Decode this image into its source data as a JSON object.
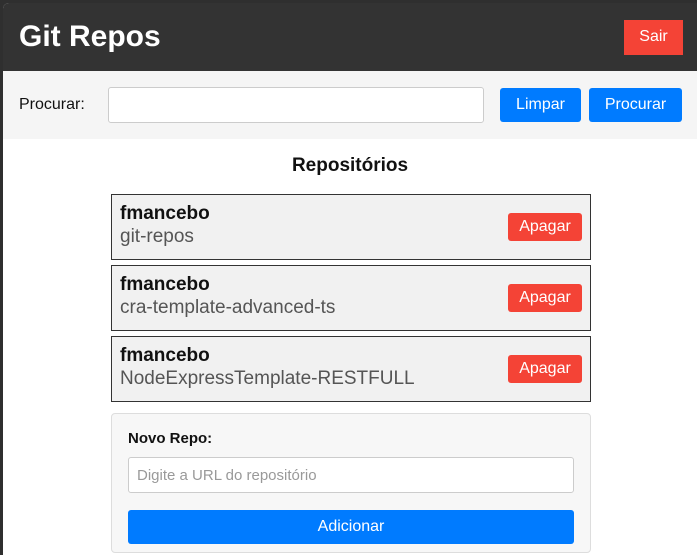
{
  "header": {
    "title": "Git Repos",
    "logout_label": "Sair"
  },
  "search": {
    "label": "Procurar:",
    "value": "",
    "placeholder": "",
    "clear_label": "Limpar",
    "submit_label": "Procurar"
  },
  "repos": {
    "title": "Repositórios",
    "delete_label": "Apagar",
    "items": [
      {
        "owner": "fmancebo",
        "name": "git-repos"
      },
      {
        "owner": "fmancebo",
        "name": "cra-template-advanced-ts"
      },
      {
        "owner": "fmancebo",
        "name": "NodeExpressTemplate-RESTFULL"
      }
    ]
  },
  "new_repo": {
    "label": "Novo Repo:",
    "placeholder": "Digite a URL do repositório",
    "value": "",
    "submit_label": "Adicionar"
  },
  "colors": {
    "header_bg": "#333333",
    "danger": "#f44336",
    "primary": "#007bff"
  }
}
